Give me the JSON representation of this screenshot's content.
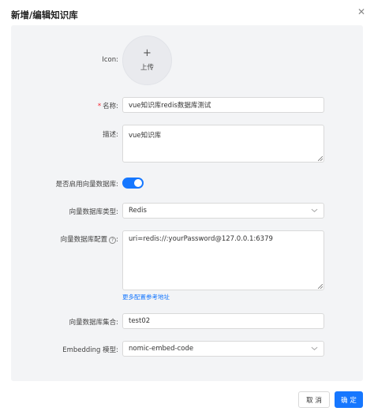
{
  "modal": {
    "title": "新增/编辑知识库",
    "close_glyph": "✕"
  },
  "form": {
    "icon": {
      "label": "Icon:",
      "upload_plus": "+",
      "upload_text": "上传"
    },
    "name": {
      "required_mark": "*",
      "label": "名称:",
      "value": "vue知识库redis数据库测试"
    },
    "description": {
      "label": "描述:",
      "value": "vue知识库"
    },
    "vector_enabled": {
      "label": "是否启用向量数据库:",
      "on": true
    },
    "vector_db_type": {
      "label": "向量数据库类型:",
      "value": "Redis"
    },
    "vector_db_config": {
      "label": "向量数据库配置",
      "help_glyph": "?",
      "value": "uri=redis://:yourPassword@127.0.0.1:6379",
      "more_link": "更多配置参考地址"
    },
    "vector_collection": {
      "label": "向量数据库集合:",
      "value": "test02"
    },
    "embedding_model": {
      "label": "Embedding 模型:",
      "value": "nomic-embed-code"
    }
  },
  "footer": {
    "cancel_label": "取 消",
    "ok_label": "确 定"
  },
  "colors": {
    "primary": "#1677ff",
    "required": "#f5222d",
    "panel_bg": "#f3f4f6"
  }
}
